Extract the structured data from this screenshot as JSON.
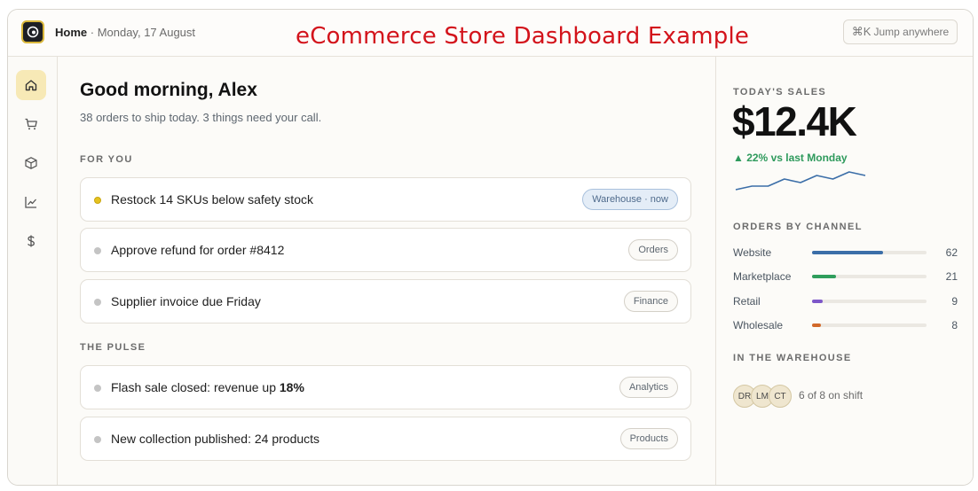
{
  "header": {
    "home": "Home",
    "separator": " · ",
    "date": "Monday, 17 August",
    "headline": "eCommerce Store Dashboard Example",
    "jump_shortcut": "⌘K",
    "jump_label": "Jump anywhere"
  },
  "sidebar": {
    "items": [
      {
        "icon": "home-icon",
        "active": true
      },
      {
        "icon": "cart-icon",
        "active": false
      },
      {
        "icon": "box-icon",
        "active": false
      },
      {
        "icon": "chart-icon",
        "active": false
      },
      {
        "icon": "dollar-icon",
        "active": false
      }
    ]
  },
  "main": {
    "greeting": "Good morning, Alex",
    "subtitle": "38 orders to ship today. 3 things need your call.",
    "for_you_label": "FOR YOU",
    "for_you": [
      {
        "text": "Restock 14 SKUs below safety stock",
        "tag": "Warehouse · now",
        "urgent": true
      },
      {
        "text": "Approve refund for order #8412",
        "tag": "Orders",
        "urgent": false
      },
      {
        "text": "Supplier invoice due Friday",
        "tag": "Finance",
        "urgent": false
      }
    ],
    "pulse_label": "THE PULSE",
    "pulse": [
      {
        "text_prefix": "Flash sale closed: revenue up ",
        "text_bold": "18%",
        "tag": "Analytics"
      },
      {
        "text_prefix": "New collection published: 24 products",
        "text_bold": "",
        "tag": "Products"
      }
    ]
  },
  "aside": {
    "sales_label": "TODAY'S SALES",
    "sales_value": "$12.4K",
    "delta_text": "▲ 22% vs last Monday",
    "sparkline": [
      14,
      15,
      15,
      17,
      16,
      18,
      17,
      19,
      18
    ],
    "channels_label": "ORDERS BY CHANNEL",
    "channels": [
      {
        "name": "Website",
        "count": "62",
        "value": 62,
        "color": "#3b6ea8"
      },
      {
        "name": "Marketplace",
        "count": "21",
        "value": 21,
        "color": "#2f9e5c"
      },
      {
        "name": "Retail",
        "count": "9",
        "value": 9,
        "color": "#7d57c9"
      },
      {
        "name": "Wholesale",
        "count": "8",
        "value": 8,
        "color": "#d2692a"
      }
    ],
    "warehouse_label": "IN THE WAREHOUSE",
    "staff": [
      "DR",
      "LM",
      "CT"
    ],
    "shift_text": "6 of 8 on shift"
  },
  "colors": {
    "accent": "#f7e9b6",
    "headline": "#d3131b",
    "positive": "#2e9a5c",
    "tag_highlight": "#e4edf7"
  }
}
